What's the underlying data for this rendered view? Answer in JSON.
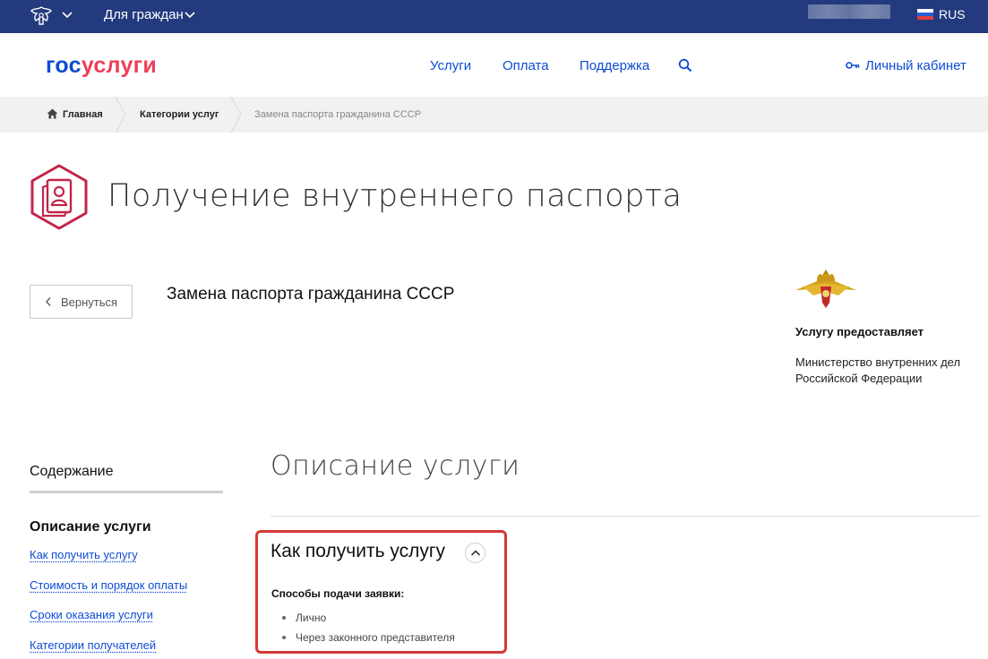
{
  "topbar": {
    "citizens_label": "Для граждан",
    "language": "RUS"
  },
  "header": {
    "logo_part1": "гос",
    "logo_part2": "услуги",
    "nav": [
      "Услуги",
      "Оплата",
      "Поддержка"
    ],
    "cabinet_label": "Личный кабинет"
  },
  "breadcrumbs": {
    "home": "Главная",
    "categories": "Категории услуг",
    "current": "Замена паспорта гражданина СССР"
  },
  "page": {
    "title": "Получение внутреннего паспорта",
    "back_label": "Вернуться",
    "service_name": "Замена паспорта гражданина СССР"
  },
  "provider": {
    "label": "Услугу предоставляет",
    "name": "Министерство внутренних дел Российской Федерации"
  },
  "sidebar": {
    "title": "Содержание",
    "current": "Описание услуги",
    "links": [
      "Как получить услугу",
      "Стоимость и порядок оплаты",
      "Сроки оказания услуги",
      "Категории получателей"
    ]
  },
  "main": {
    "section_title": "Описание услуги",
    "how_title": "Как получить услугу",
    "methods_label": "Способы подачи заявки:",
    "methods": [
      "Лично",
      "Через законного представителя"
    ]
  },
  "colors": {
    "topbar": "#233a7e",
    "link": "#0d4cd3",
    "logo_red": "#ee3f58",
    "highlight": "#d33a35",
    "icon_accent": "#c2254a"
  }
}
